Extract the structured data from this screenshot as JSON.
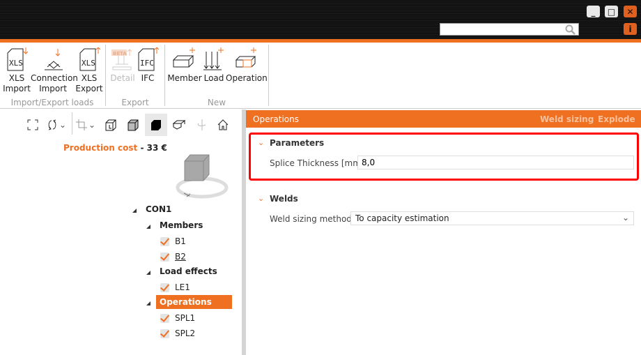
{
  "window": {
    "minimize": "_",
    "maximize": "□",
    "close": "✕",
    "info": "i",
    "search_placeholder": ""
  },
  "ribbon": {
    "groups": [
      {
        "label": "Import/Export loads",
        "buttons": [
          {
            "label1": "XLS",
            "label2": "Import"
          },
          {
            "label1": "Connection",
            "label2": "Import"
          },
          {
            "label1": "XLS",
            "label2": "Export"
          }
        ]
      },
      {
        "label": "Export",
        "buttons": [
          {
            "label1": "Detail",
            "badge": "BETA",
            "disabled": true
          },
          {
            "label1": "IFC"
          }
        ]
      },
      {
        "label": "New",
        "buttons": [
          {
            "label1": "Member"
          },
          {
            "label1": "Load"
          },
          {
            "label1": "Operation"
          }
        ]
      }
    ]
  },
  "left": {
    "toolbar": [
      "fit-icon",
      "rotate-icon",
      "crop-icon",
      "wireframe-icon",
      "transparent-icon",
      "solid-icon",
      "section-icon",
      "mirror-icon",
      "home-icon"
    ],
    "production_cost_label": "Production cost",
    "production_cost_sep": "-",
    "production_cost_value": "33 €",
    "tree": {
      "root": "CON1",
      "members_label": "Members",
      "members": [
        "B1",
        "B2"
      ],
      "loads_label": "Load effects",
      "loads": [
        "LE1"
      ],
      "operations_label": "Operations",
      "operations": [
        "SPL1",
        "SPL2"
      ]
    }
  },
  "right": {
    "header": "Operations",
    "actions": [
      "Weld sizing",
      "Explode"
    ],
    "parameters": {
      "title": "Parameters",
      "splice_label": "Splice Thickness [mm]",
      "splice_value": "8,0"
    },
    "welds": {
      "title": "Welds",
      "method_label": "Weld sizing method",
      "method_value": "To capacity estimation"
    }
  },
  "colors": {
    "accent": "#f07022",
    "highlight": "#ff0000"
  }
}
